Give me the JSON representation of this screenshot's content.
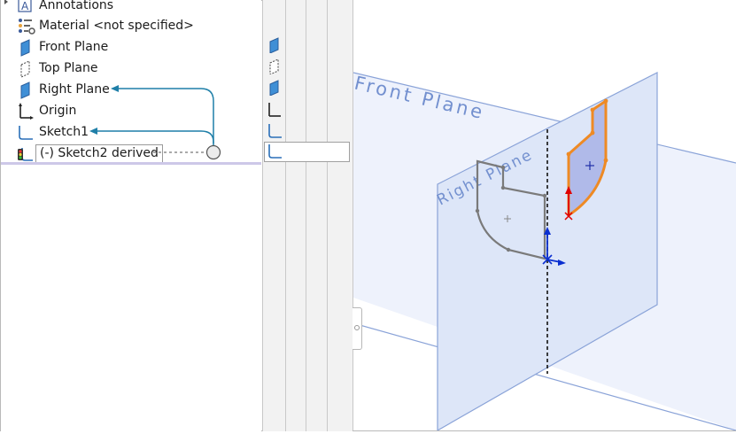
{
  "feature_tree": {
    "items": [
      {
        "label": "Annotations",
        "icon": "annotations-icon",
        "expandable": true
      },
      {
        "label": "Material <not specified>",
        "icon": "material-icon"
      },
      {
        "label": "Front Plane",
        "icon": "plane-icon"
      },
      {
        "label": "Top Plane",
        "icon": "plane-hidden-icon"
      },
      {
        "label": "Right Plane",
        "icon": "plane-icon"
      },
      {
        "label": "Origin",
        "icon": "origin-icon"
      },
      {
        "label": "Sketch1",
        "icon": "sketch-icon"
      },
      {
        "label": "(-) Sketch2 derived",
        "icon": "derived-sketch-icon",
        "selected": true
      }
    ]
  },
  "viewport": {
    "front_plane_label": "Front Plane",
    "right_plane_label": "Right Plane"
  },
  "colors": {
    "plane_fill": "#dde6f8",
    "plane_edge": "#5d7fc4",
    "plane_text": "#6f8ccc",
    "connector_arrow": "#1f7fa8",
    "sketch_gray": "#7a7a7a",
    "derived_orange": "#ee8a24",
    "derived_fill": "#a8b2e6",
    "axis_red": "#e00000",
    "axis_blue": "#0a2fd0"
  }
}
